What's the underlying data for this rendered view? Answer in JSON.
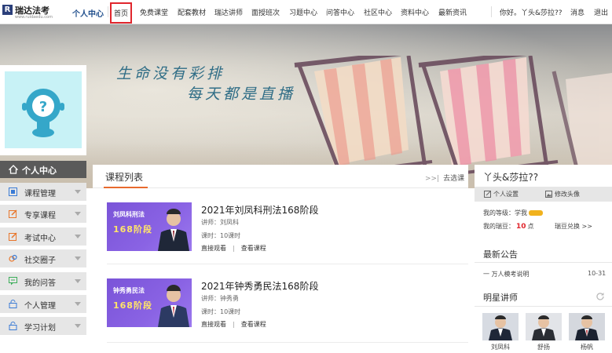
{
  "header": {
    "logo_text": "瑞达法考",
    "logo_url": "www.ruidaedu.com",
    "personal_center": "个人中心",
    "nav": [
      "首页",
      "免费课堂",
      "配套教材",
      "瑞达讲师",
      "面授班次",
      "习题中心",
      "问答中心",
      "社区中心",
      "资料中心",
      "最新资讯"
    ],
    "active_nav": "首页",
    "greeting": "你好。丫头&莎拉??",
    "messages": "消息",
    "logout": "退出"
  },
  "banner": {
    "slogan_line1": "生命没有彩排",
    "slogan_line2": "每天都是直播"
  },
  "sidebar": {
    "title": "个人中心",
    "items": [
      {
        "label": "课程管理",
        "icon": "course-icon"
      },
      {
        "label": "专享课程",
        "icon": "edit-icon"
      },
      {
        "label": "考试中心",
        "icon": "exam-icon"
      },
      {
        "label": "社交圈子",
        "icon": "social-icon"
      },
      {
        "label": "我的问答",
        "icon": "chat-icon"
      },
      {
        "label": "个人管理",
        "icon": "lock-icon"
      },
      {
        "label": "学习计划",
        "icon": "plan-icon"
      }
    ]
  },
  "main": {
    "title": "课程列表",
    "more": "去选课",
    "courses": [
      {
        "thumb_title": "刘凤科刑法",
        "thumb_sub": "168阶段",
        "title": "2021年刘凤科刑法168阶段",
        "teacher": "讲师：刘凤科",
        "hours": "课时：10课时",
        "watch": "直接观看",
        "view": "查看课程"
      },
      {
        "thumb_title": "钟秀勇民法",
        "thumb_sub": "168阶段",
        "title": "2021年钟秀勇民法168阶段",
        "teacher": "讲师：钟秀勇",
        "hours": "课时：10课时",
        "watch": "直接观看",
        "view": "查看课程"
      }
    ]
  },
  "right": {
    "username": "丫头&莎拉??",
    "settings": "个人设置",
    "change_avatar": "修改头像",
    "level_label": "我的等级：",
    "level_value": "学我",
    "beans_label": "我的瑞豆：",
    "beans_value": "10",
    "beans_unit": "点",
    "redeem": "瑞豆兑换 >>",
    "announcement_title": "最新公告",
    "announcement_text": "一 万人模考说明",
    "announcement_date": "10-31",
    "teachers_title": "明星讲师",
    "teachers": [
      "刘凤科",
      "舒扬",
      "杨帆"
    ]
  },
  "colors": {
    "accent_red": "#e0262d",
    "nav_blue": "#1f4e8c",
    "thumb_purple": "#7a54d8",
    "tab_orange": "#e86a2e",
    "sidebar_dark": "#5a5a5a"
  }
}
